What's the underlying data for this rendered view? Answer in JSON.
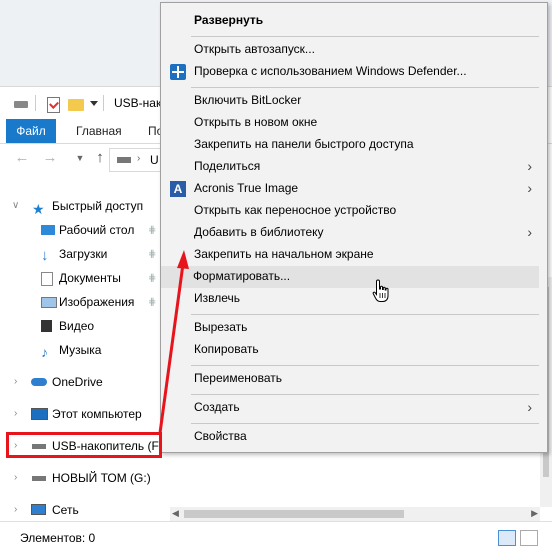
{
  "explorer": {
    "title": "USB-нако",
    "ribbon_tabs": {
      "file": "Файл",
      "home": "Главная",
      "share": "По"
    },
    "address_text": "U",
    "nav_items": [
      {
        "label": "Быстрый доступ",
        "icon": "star-icon"
      },
      {
        "label": "Рабочий стол",
        "icon": "desktop-folder-icon",
        "pinned": true
      },
      {
        "label": "Загрузки",
        "icon": "downloads-icon",
        "pinned": true
      },
      {
        "label": "Документы",
        "icon": "documents-icon",
        "pinned": true
      },
      {
        "label": "Изображения",
        "icon": "pictures-icon",
        "pinned": true
      },
      {
        "label": "Видео",
        "icon": "video-icon"
      },
      {
        "label": "Музыка",
        "icon": "music-icon"
      },
      {
        "label": "OneDrive",
        "icon": "cloud-icon"
      },
      {
        "label": "Этот компьютер",
        "icon": "computer-icon"
      },
      {
        "label": "USB-накопитель (F:",
        "icon": "usb-drive-icon"
      },
      {
        "label": "НОВЫЙ ТОМ (G:)",
        "icon": "drive-icon"
      },
      {
        "label": "Сеть",
        "icon": "network-icon"
      }
    ],
    "status": "Элементов: 0"
  },
  "context_menu": {
    "items": [
      {
        "label": "Развернуть",
        "bold": true
      },
      {
        "label": "Открыть автозапуск..."
      },
      {
        "label": "Проверка с использованием Windows Defender...",
        "icon": "windows-defender-icon"
      },
      {
        "label": "Включить BitLocker"
      },
      {
        "label": "Открыть в новом окне"
      },
      {
        "label": "Закрепить на панели быстрого доступа"
      },
      {
        "label": "Поделиться",
        "submenu": true
      },
      {
        "label": "Acronis True Image",
        "icon": "acronis-icon",
        "submenu": true
      },
      {
        "label": "Открыть как переносное устройство"
      },
      {
        "label": "Добавить в библиотеку",
        "submenu": true
      },
      {
        "label": "Закрепить на начальном экране"
      },
      {
        "label": "Форматировать...",
        "hovered": true
      },
      {
        "label": "Извлечь"
      },
      {
        "label": "Вырезать"
      },
      {
        "label": "Копировать"
      },
      {
        "label": "Переименовать"
      },
      {
        "label": "Создать",
        "submenu": true
      },
      {
        "label": "Свойства"
      }
    ],
    "acronis_glyph": "A"
  },
  "colors": {
    "accent": "#1979ca",
    "highlight_red": "#e8141c",
    "menu_bg": "#f2f2f2",
    "hover_bg": "#e2e2e2"
  }
}
